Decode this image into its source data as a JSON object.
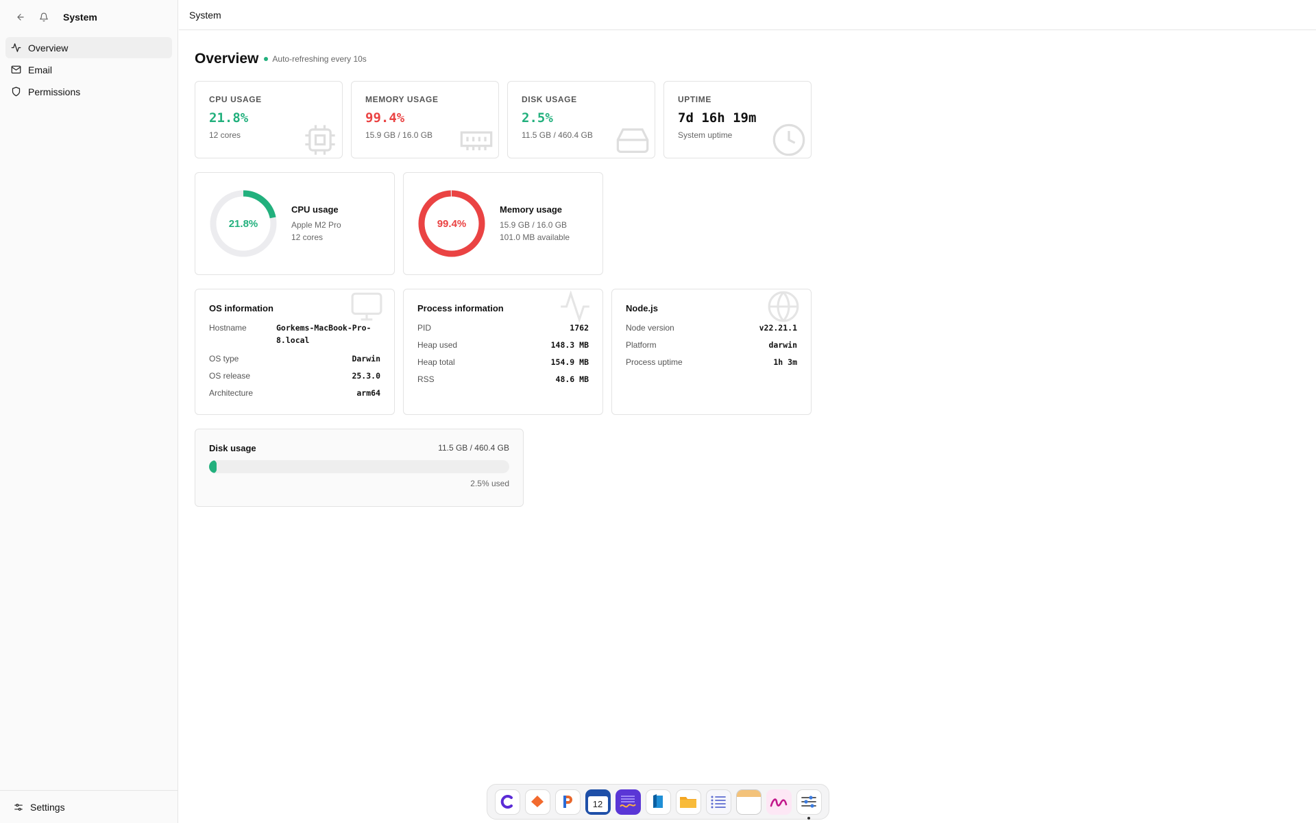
{
  "sidebar": {
    "title": "System",
    "items": [
      {
        "label": "Overview",
        "icon": "activity-icon"
      },
      {
        "label": "Email",
        "icon": "mail-icon"
      },
      {
        "label": "Permissions",
        "icon": "shield-icon"
      }
    ],
    "footer_label": "Settings"
  },
  "topbar": {
    "title": "System"
  },
  "page": {
    "title": "Overview",
    "refresh_text": "Auto-refreshing every 10s"
  },
  "stats": [
    {
      "label": "CPU USAGE",
      "value": "21.8%",
      "sub": "12 cores",
      "color": "#22b07d"
    },
    {
      "label": "MEMORY USAGE",
      "value": "99.4%",
      "sub": "15.9 GB / 16.0 GB",
      "color": "#ea4343"
    },
    {
      "label": "DISK USAGE",
      "value": "2.5%",
      "sub": "11.5 GB / 460.4 GB",
      "color": "#22b07d"
    },
    {
      "label": "UPTIME",
      "value": "7d 16h 19m",
      "sub": "System uptime",
      "color": "#111111"
    }
  ],
  "gauges": {
    "cpu": {
      "percent": 21.8,
      "label": "21.8%",
      "title": "CPU usage",
      "line1": "Apple M2 Pro",
      "line2": "12 cores",
      "color": "#22b07d"
    },
    "memory": {
      "percent": 99.4,
      "label": "99.4%",
      "title": "Memory usage",
      "line1": "15.9 GB / 16.0 GB",
      "line2": "101.0 MB available",
      "color": "#ea4343"
    }
  },
  "os_info": {
    "title": "OS information",
    "hostname_label": "Hostname",
    "hostname": "Gorkems-MacBook-Pro-8.local",
    "type_label": "OS type",
    "type": "Darwin",
    "release_label": "OS release",
    "release": "25.3.0",
    "arch_label": "Architecture",
    "arch": "arm64"
  },
  "process_info": {
    "title": "Process information",
    "pid_label": "PID",
    "pid": "1762",
    "heap_used_label": "Heap used",
    "heap_used": "148.3 MB",
    "heap_total_label": "Heap total",
    "heap_total": "154.9 MB",
    "rss_label": "RSS",
    "rss": "48.6 MB"
  },
  "node_info": {
    "title": "Node.js",
    "version_label": "Node version",
    "version": "v22.21.1",
    "platform_label": "Platform",
    "platform": "darwin",
    "uptime_label": "Process uptime",
    "uptime": "1h 3m"
  },
  "disk": {
    "title": "Disk usage",
    "value": "11.5 GB / 460.4 GB",
    "percent": 2.5,
    "used_text": "2.5% used"
  },
  "dock": {
    "apps": [
      "c-app-icon",
      "orange-app-icon",
      "p-app-icon",
      "calendar-icon",
      "purple-notes-icon",
      "blue-book-icon",
      "folder-icon",
      "list-icon",
      "notepad-icon",
      "scribble-icon",
      "sliders-icon"
    ],
    "calendar_day": "12"
  }
}
